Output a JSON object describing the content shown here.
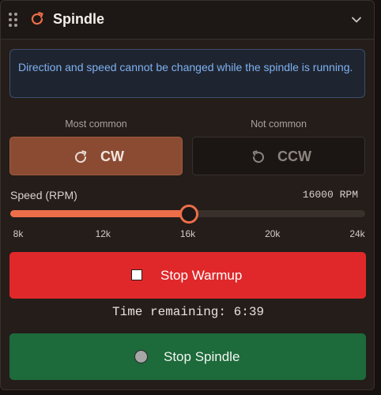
{
  "header": {
    "title": "Spindle"
  },
  "notice": {
    "text": "Direction and speed cannot be changed while the spindle is running."
  },
  "direction": {
    "cw": {
      "caption": "Most common",
      "label": "CW"
    },
    "ccw": {
      "caption": "Not common",
      "label": "CCW"
    }
  },
  "speed": {
    "label": "Speed (RPM)",
    "value_text": "16000 RPM",
    "value": 16000,
    "min": 8000,
    "max": 24000,
    "ticks": [
      "8k",
      "12k",
      "16k",
      "20k",
      "24k"
    ]
  },
  "warmup": {
    "label": "Stop Warmup",
    "remaining": "Time remaining: 6:39"
  },
  "stop_spindle": {
    "label": "Stop Spindle"
  },
  "colors": {
    "accent": "#ee6e4a",
    "warmup_bg": "#e0282a",
    "stop_bg": "#1d6a3a",
    "notice_text": "#7fb1f2"
  }
}
